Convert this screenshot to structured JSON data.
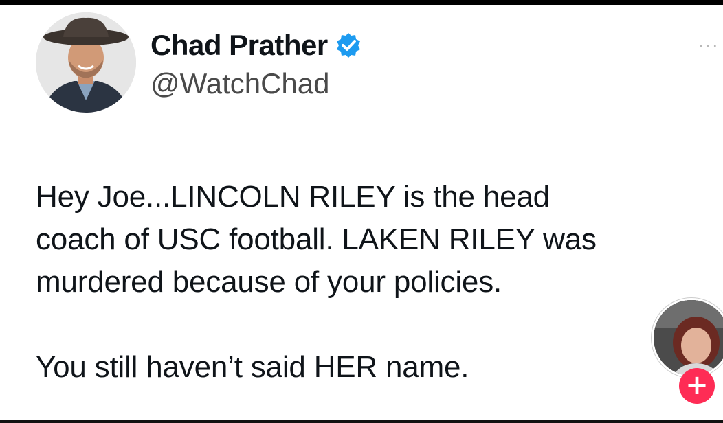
{
  "author": {
    "display_name": "Chad Prather",
    "handle": "@WatchChad",
    "verified": true
  },
  "tweet": {
    "lines": [
      "Hey Joe...LINCOLN RILEY is the head",
      "coach of USC football. LAKEN RILEY was",
      "murdered because of your policies.",
      "",
      "You still haven’t said HER name."
    ]
  },
  "more_label": "···",
  "overlay": {
    "follow_label": "+"
  },
  "colors": {
    "verified": "#1d9bf0",
    "follow_button": "#fe2c55",
    "text": "#0f1419"
  },
  "icons": [
    "verified-badge-icon",
    "more-options-icon",
    "plus-icon"
  ]
}
